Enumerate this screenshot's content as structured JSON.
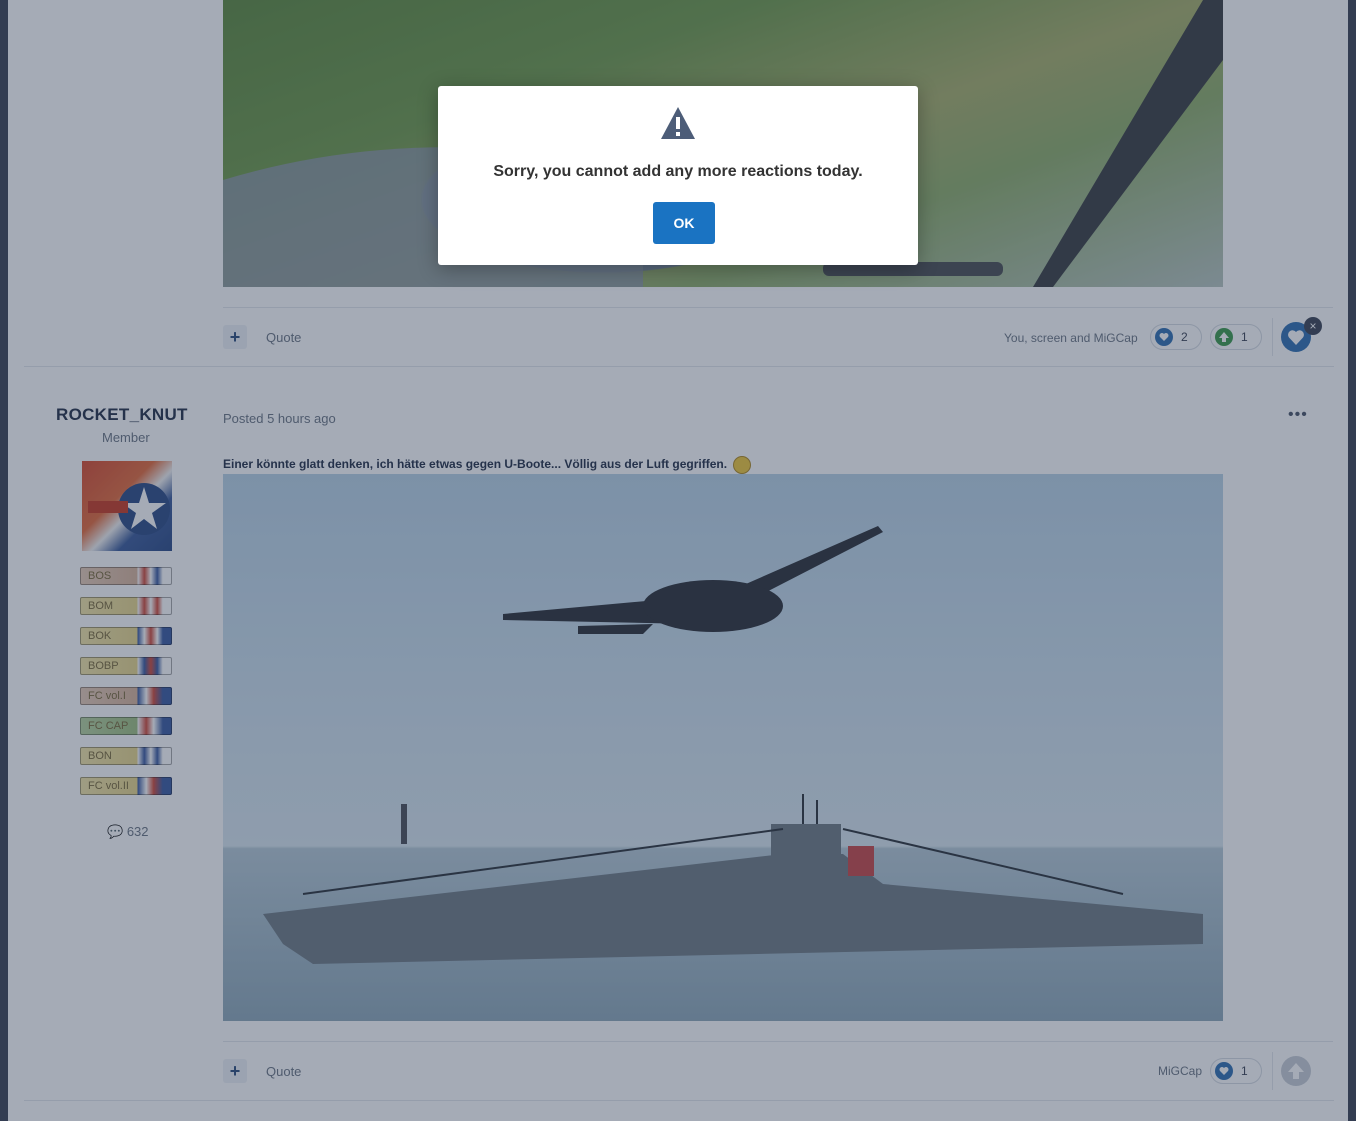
{
  "post1": {
    "quote_label": "Quote",
    "add_label": "+",
    "reaction_names": "You, screen and MiGCap",
    "reactions": [
      {
        "icon": "heart-icon",
        "count": "2"
      },
      {
        "icon": "upvote-icon",
        "count": "1"
      }
    ],
    "remove_label": "×"
  },
  "post2": {
    "author": "ROCKET_KNUT",
    "role": "Member",
    "posted": "Posted 5 hours ago",
    "more_label": "•••",
    "text": "Einer könnte glatt denken, ich hätte etwas gegen U-Boote... Völlig aus der Luft gegriffen.",
    "post_count": "632",
    "badges": [
      "BOS",
      "BOM",
      "BOK",
      "BOBP",
      "FC vol.I",
      "FC CAP",
      "BON",
      "FC vol.II"
    ],
    "quote_label": "Quote",
    "add_label": "+",
    "reaction_names": "MiGCap",
    "reactions": [
      {
        "icon": "heart-icon",
        "count": "1"
      }
    ]
  },
  "modal": {
    "message": "Sorry, you cannot add any more reactions today.",
    "ok_label": "OK",
    "icon": "warning-icon"
  }
}
